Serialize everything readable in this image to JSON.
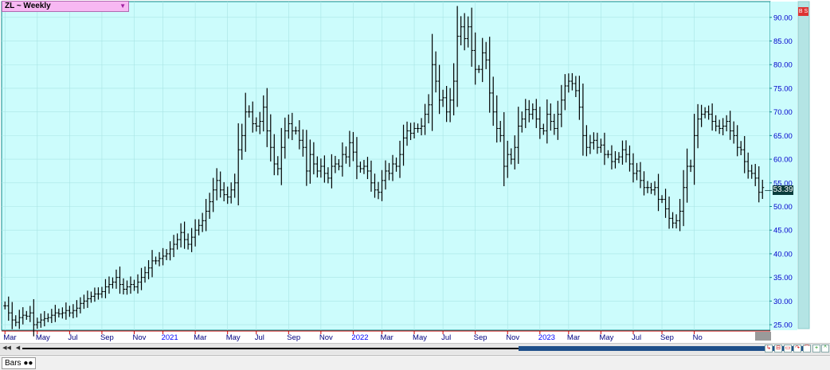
{
  "header": {
    "symbol_label": "ZL ~ Weekly",
    "corner_badge": "B S"
  },
  "footer": {
    "tab_label": "Bars"
  },
  "colors": {
    "plot_bg": "#ccfcfc",
    "grid": "#a8e4e4",
    "bars": "#000000",
    "axis": "#0000ff",
    "last_price_bg": "#0b3c3c",
    "scrollbar_thumb": "#1e4f8a"
  },
  "chart_data": {
    "type": "ohlc",
    "title": "ZL ~ Weekly",
    "ylim": [
      24,
      93
    ],
    "y_ticks": [
      "25.00",
      "30.00",
      "35.00",
      "40.00",
      "45.00",
      "50.00",
      "55.00",
      "60.00",
      "65.00",
      "70.00",
      "75.00",
      "80.00",
      "85.00",
      "90.00"
    ],
    "x_labels": [
      {
        "label": "Mar",
        "week": 0,
        "year": false
      },
      {
        "label": "May",
        "week": 9,
        "year": false
      },
      {
        "label": "Jul",
        "week": 18,
        "year": false
      },
      {
        "label": "Sep",
        "week": 27,
        "year": false
      },
      {
        "label": "Nov",
        "week": 36,
        "year": false
      },
      {
        "label": "2021",
        "week": 44,
        "year": true
      },
      {
        "label": "Mar",
        "week": 53,
        "year": false
      },
      {
        "label": "May",
        "week": 62,
        "year": false
      },
      {
        "label": "Jul",
        "week": 70,
        "year": false
      },
      {
        "label": "Sep",
        "week": 79,
        "year": false
      },
      {
        "label": "Nov",
        "week": 88,
        "year": false
      },
      {
        "label": "2022",
        "week": 97,
        "year": true
      },
      {
        "label": "Mar",
        "week": 105,
        "year": false
      },
      {
        "label": "May",
        "week": 114,
        "year": false
      },
      {
        "label": "Jul",
        "week": 122,
        "year": false
      },
      {
        "label": "Sep",
        "week": 131,
        "year": false
      },
      {
        "label": "Nov",
        "week": 140,
        "year": false
      },
      {
        "label": "2023",
        "week": 149,
        "year": true
      },
      {
        "label": "Mar",
        "week": 157,
        "year": false
      },
      {
        "label": "May",
        "week": 166,
        "year": false
      },
      {
        "label": "Jul",
        "week": 175,
        "year": false
      },
      {
        "label": "Sep",
        "week": 183,
        "year": false
      },
      {
        "label": "No",
        "week": 192,
        "year": false
      }
    ],
    "last_price": "53.39",
    "grid": true,
    "series_close": [
      29,
      27.5,
      26,
      25.5,
      26.5,
      27,
      26.8,
      27.5,
      25,
      25.5,
      26,
      26.3,
      26.5,
      27,
      27.5,
      27.3,
      27.5,
      28,
      27.5,
      28,
      28.5,
      29.5,
      30,
      30.5,
      31,
      31.5,
      31.5,
      32,
      33,
      33.5,
      34,
      35,
      33.5,
      32.5,
      33,
      33.5,
      33,
      34,
      35,
      36,
      37,
      38.5,
      38.5,
      39,
      39.5,
      40,
      41,
      42,
      43,
      44.5,
      43,
      42,
      43.5,
      45,
      46,
      47,
      49,
      51,
      53.5,
      55.5,
      53.5,
      52.5,
      52,
      53.5,
      55,
      62,
      65,
      70,
      70,
      67.5,
      67,
      68,
      71,
      66,
      62.5,
      59,
      58,
      62.5,
      66,
      67.5,
      66,
      66,
      64,
      62.5,
      57.5,
      61,
      59,
      57.5,
      58.5,
      57,
      56,
      58.5,
      59,
      58.5,
      61,
      60.5,
      63.5,
      61.5,
      58.5,
      58,
      58.5,
      57.5,
      55,
      53.5,
      53,
      55.5,
      57.5,
      57,
      59,
      58.5,
      61,
      64.5,
      66,
      65.5,
      66.5,
      66.5,
      67,
      69.5,
      71.5,
      80,
      76.5,
      72.5,
      73,
      70,
      72.5,
      76.5,
      86,
      88,
      85.5,
      88,
      83,
      79,
      79,
      82.5,
      81,
      74,
      70,
      66.5,
      65,
      58.5,
      61,
      60,
      62.5,
      67,
      68.5,
      70.5,
      69.5,
      70.5,
      68.5,
      66.5,
      66,
      69.5,
      68,
      66.5,
      69.5,
      72.5,
      75.5,
      76.5,
      76,
      74.5,
      71,
      65,
      62.5,
      63.5,
      64,
      62.5,
      63,
      61,
      61,
      59.5,
      60,
      60.5,
      62,
      61,
      59,
      57,
      57.5,
      55.5,
      54,
      54,
      53.5,
      54,
      51.5,
      51.5,
      49.5,
      47.5,
      46.5,
      47,
      49,
      54,
      58.5,
      58.5,
      65,
      68.5,
      69.5,
      70,
      69.5,
      68,
      67,
      66.5,
      67,
      68,
      66,
      65,
      62.5,
      62,
      59.5,
      57.5,
      57,
      56,
      53,
      54
    ]
  }
}
